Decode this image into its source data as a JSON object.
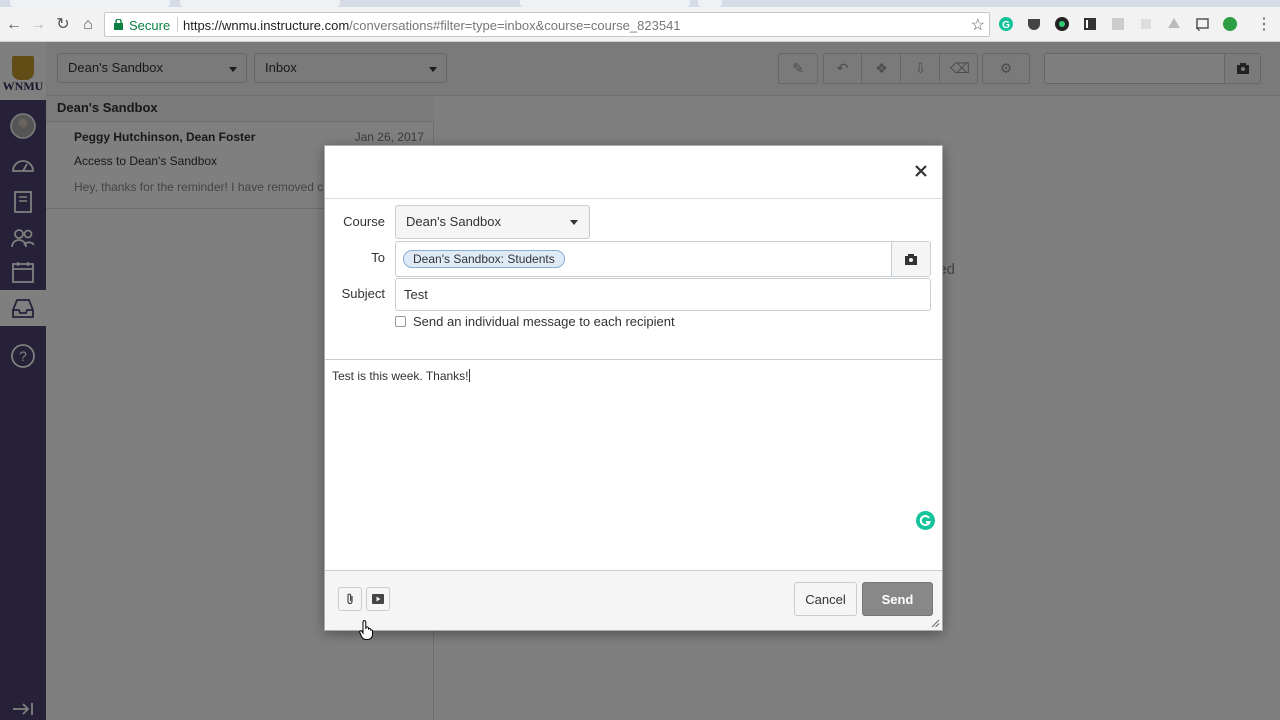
{
  "browser": {
    "secure_label": "Secure",
    "url_host": "https://wnmu.instructure.com",
    "url_path": "/conversations#filter=type=inbox&course=course_823541"
  },
  "nav": {
    "logo_text": "WNMU"
  },
  "inbox": {
    "course_filter": "Dean's Sandbox",
    "type_filter": "Inbox",
    "list_header": "Dean's Sandbox",
    "conversation": {
      "participants": "Peggy Hutchinson, Dean Foster",
      "date": "Jan 26, 2017",
      "subject": "Access to Dean's Sandbox",
      "preview": "Hey, thanks for the reminder! I have removed course shell."
    },
    "detail_empty_fragment": "ed"
  },
  "dialog": {
    "course_label": "Course",
    "course_value": "Dean's Sandbox",
    "to_label": "To",
    "to_token": "Dean's Sandbox: Students",
    "subject_label": "Subject",
    "subject_value": "Test",
    "individual_label": "Send an individual message to each recipient",
    "body_text": "Test is this week. Thanks!",
    "cancel_label": "Cancel",
    "send_label": "Send"
  },
  "colors": {
    "nav_rail": "#4c4271",
    "send_button": "#888888",
    "grammarly": "#15c39a",
    "secure": "#0b8043"
  }
}
